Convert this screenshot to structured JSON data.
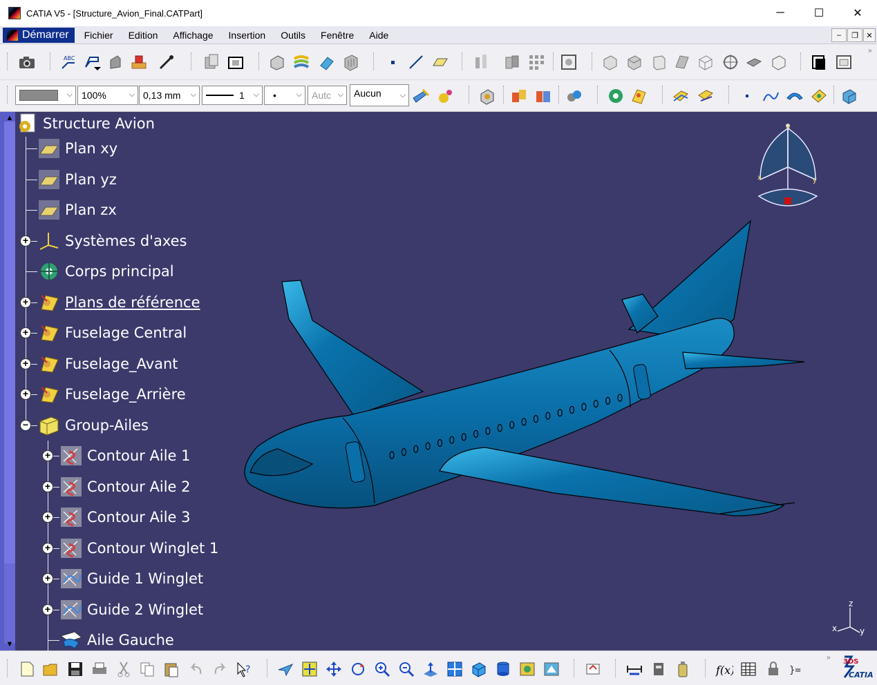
{
  "window": {
    "title": "CATIA V5 - [Structure_Avion_Final.CATPart]",
    "minimize": "─",
    "maximize": "☐",
    "close": "✕"
  },
  "menu": {
    "start": "Démarrer",
    "items": [
      "Fichier",
      "Edition",
      "Affichage",
      "Insertion",
      "Outils",
      "Fenêtre",
      "Aide"
    ],
    "mdi_minimize": "–",
    "mdi_restore": "❐",
    "mdi_close": "✕"
  },
  "properties_bar": {
    "color_value": "",
    "transparency": "100%",
    "line_thickness": "0,13 mm",
    "line_type": "1",
    "point_symbol": "•",
    "layer": "Autc",
    "rendering": "Aucun"
  },
  "tree": {
    "root": "Structure Avion",
    "nodes": [
      {
        "label": "Plan xy",
        "icon": "plane-icon",
        "expandable": false
      },
      {
        "label": "Plan yz",
        "icon": "plane-icon",
        "expandable": false
      },
      {
        "label": "Plan zx",
        "icon": "plane-icon",
        "expandable": false
      },
      {
        "label": "Systèmes d'axes",
        "icon": "axis-system-icon",
        "expandable": true
      },
      {
        "label": "Corps principal",
        "icon": "part-body-icon",
        "expandable": false
      },
      {
        "label": "Plans de référence",
        "icon": "geometrical-set-icon",
        "expandable": true,
        "underlined": true
      },
      {
        "label": "Fuselage Central",
        "icon": "geometrical-set-icon",
        "expandable": true
      },
      {
        "label": "Fuselage_Avant",
        "icon": "geometrical-set-icon",
        "expandable": true
      },
      {
        "label": "Fuselage_Arrière",
        "icon": "geometrical-set-icon",
        "expandable": true
      },
      {
        "label": "Group-Ailes",
        "icon": "ordered-set-icon",
        "expandable": true,
        "expanded": true
      },
      {
        "label": "Contour Aile 1",
        "icon": "sketch-icon",
        "expandable": true,
        "level": 2
      },
      {
        "label": "Contour Aile 2",
        "icon": "sketch-icon",
        "expandable": true,
        "level": 2
      },
      {
        "label": "Contour Aile 3",
        "icon": "sketch-icon",
        "expandable": true,
        "level": 2
      },
      {
        "label": "Contour Winglet 1",
        "icon": "sketch-icon",
        "expandable": true,
        "level": 2
      },
      {
        "label": "Guide 1 Winglet",
        "icon": "guide-sketch-icon",
        "expandable": true,
        "level": 2
      },
      {
        "label": "Guide 2 Winglet",
        "icon": "guide-sketch-icon",
        "expandable": true,
        "level": 2
      },
      {
        "label": "Aile Gauche",
        "icon": "surface-feature-icon",
        "expandable": false,
        "level": 2
      }
    ]
  },
  "compass": {
    "x_label": "x",
    "y_label": "y",
    "z_label": "z"
  },
  "axis_triad": {
    "x_label": "x",
    "y_label": "y",
    "z_label": "z"
  },
  "logo": {
    "text": "CATIA",
    "mark": "3DS"
  },
  "colors": {
    "viewport_bg": "#3b3a6b",
    "model_color": "#0a6ea8",
    "model_highlight": "#2aa8d8",
    "menu_start_bg": "#0f2f8f",
    "sidebar": "#5a5cc8"
  }
}
